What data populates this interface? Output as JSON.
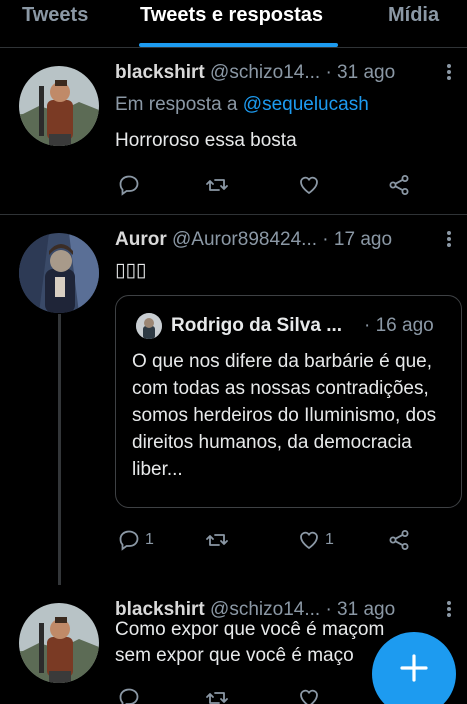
{
  "tabs": [
    {
      "label": "Tweets",
      "active": false
    },
    {
      "label": "Tweets e respostas",
      "active": true
    },
    {
      "label": "Mídia",
      "active": false
    }
  ],
  "tweets": [
    {
      "name": "blackshirt",
      "handle": "@schizo14...",
      "time": "· 31 ago",
      "reply_prefix": "Em resposta a ",
      "reply_to": "@sequelucash",
      "text": "Horroroso essa bosta",
      "actions": {
        "reply": "",
        "retweet": "",
        "like": "",
        "share": ""
      },
      "avatar_icon": "profile-photo"
    },
    {
      "name": "Auror",
      "handle": "@Auror898424...",
      "time": "· 17 ago",
      "text": "▯▯▯",
      "avatar_icon": "profile-photo",
      "quote": {
        "name": "Rodrigo da Silva ...",
        "time": "· 16 ago",
        "text": "O que nos difere da barbárie é que, com todas as nossas contradições, somos herdeiros do Iluminismo, dos direitos humanos, da democracia liber..."
      },
      "actions": {
        "reply": "1",
        "retweet": "",
        "like": "1",
        "share": ""
      }
    },
    {
      "name": "blackshirt",
      "handle": "@schizo14...",
      "time": "· 31 ago",
      "text": "Como expor que você é maçom\nsem expor que você é maço",
      "actions": {
        "reply": "",
        "retweet": "",
        "like": "",
        "share": ""
      },
      "avatar_icon": "profile-photo"
    }
  ],
  "fab": {
    "icon": "plus-icon"
  },
  "colors": {
    "accent": "#1d9bf0",
    "background": "#000000",
    "muted": "#8b98a5",
    "divider": "#2f3336"
  }
}
